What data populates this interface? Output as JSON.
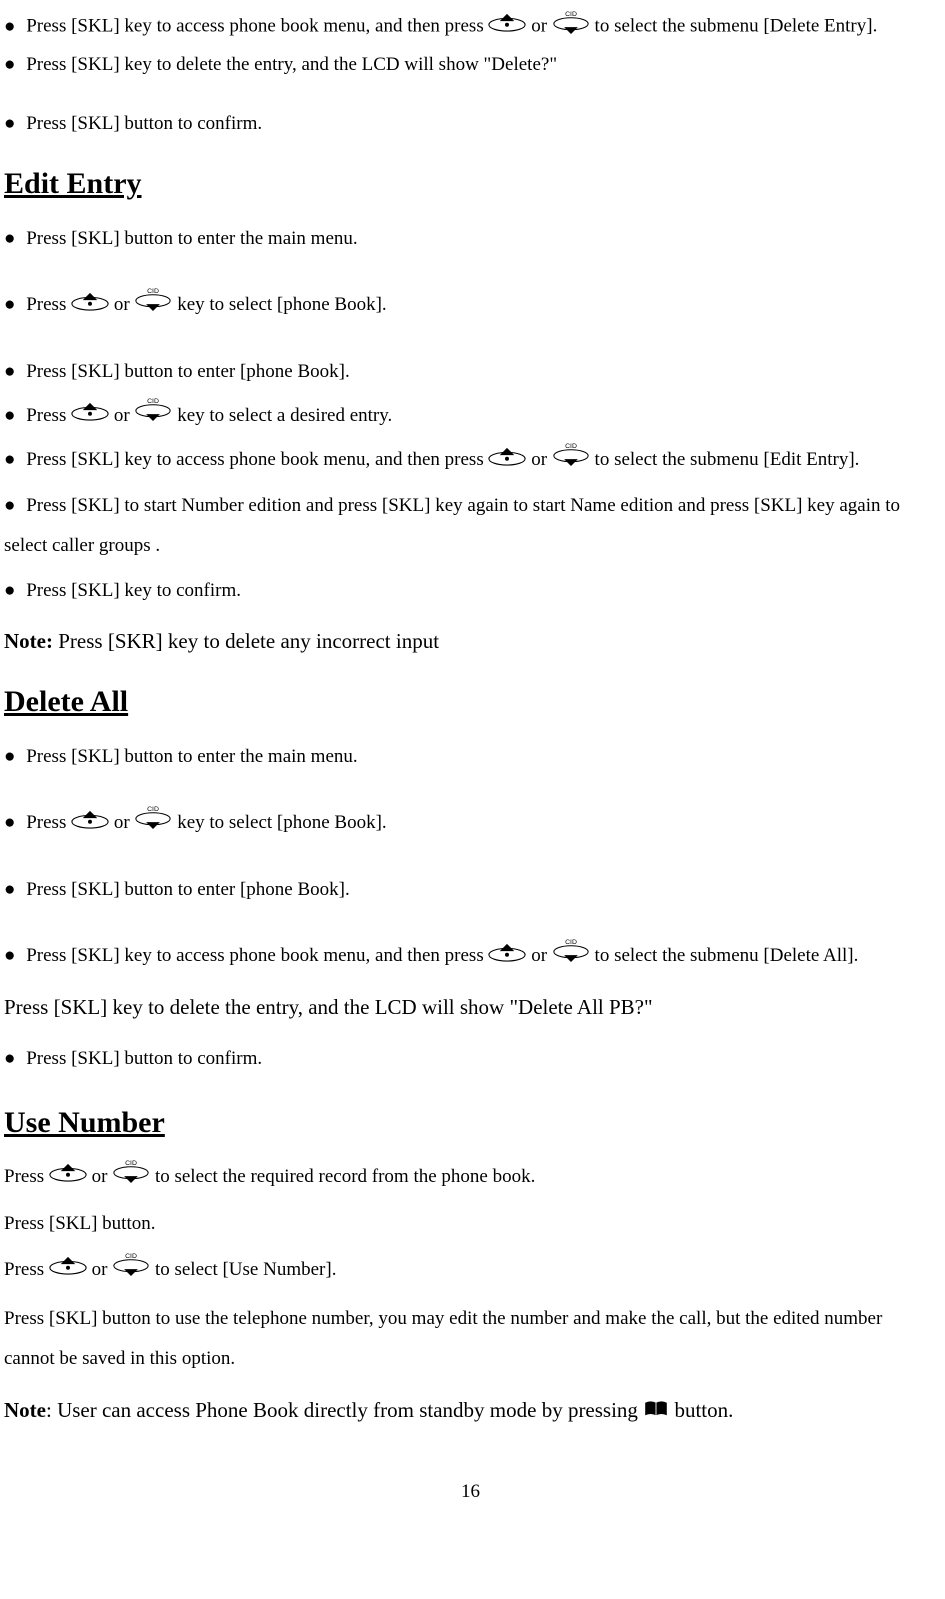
{
  "top_bullets": [
    {
      "pre": "Press [SKL] key to access phone book menu, and then press ",
      "mid": " or ",
      "post": " to select the submenu [Delete Entry]."
    },
    {
      "text": "Press [SKL] key to delete the entry, and the LCD will show \"Delete?\""
    },
    {
      "text": "Press [SKL] button to confirm."
    }
  ],
  "edit_entry": {
    "heading": "Edit Entry",
    "bullets": [
      {
        "text": "Press [SKL] button to enter the main menu."
      },
      {
        "pre": "Press ",
        "mid": " or ",
        "post": " key to select [phone Book]."
      },
      {
        "text": "Press [SKL] button to enter [phone Book]."
      },
      {
        "pre": "Press ",
        "mid": " or ",
        "post": " key to select a desired entry."
      },
      {
        "pre": "Press [SKL] key to access phone book menu, and then press ",
        "mid": " or ",
        "post": " to select the submenu [Edit Entry]."
      },
      {
        "text": "Press [SKL] to start Number edition and press [SKL] key again to start Name edition and press [SKL] key again to select caller groups ."
      },
      {
        "text": "Press [SKL] key to confirm."
      }
    ],
    "note_bold": "Note:",
    "note_text": " Press [SKR] key to delete any incorrect input"
  },
  "delete_all": {
    "heading": "Delete All",
    "bullets": [
      {
        "text": "Press [SKL] button to enter the main menu."
      },
      {
        "pre": "Press ",
        "mid": " or ",
        "post": " key to select [phone Book]."
      },
      {
        "text": "Press [SKL] button to enter [phone Book]."
      },
      {
        "pre": "Press [SKL] key to access phone book menu, and then press ",
        "mid": " or ",
        "post": " to select the submenu [Delete All]."
      }
    ],
    "line_after": "Press [SKL] key to delete the entry, and the LCD will show \"Delete All PB?\"",
    "confirm": "Press [SKL] button to confirm."
  },
  "use_number": {
    "heading": "Use Number",
    "l1_pre": "Press ",
    "l1_mid": " or ",
    "l1_post": "  to select the required record from the phone book.",
    "l2": "Press [SKL] button.",
    "l3_pre": "Press ",
    "l3_mid": " or ",
    "l3_post": " to select [Use Number].",
    "l4": "Press [SKL] button to use the telephone number, you may edit the number and make the call, but the edited number cannot be saved in this option.",
    "note_bold": "Note",
    "note_text": ": User can access Phone Book directly from standby mode by pressing ",
    "note_after": " button."
  },
  "page_number": "16"
}
